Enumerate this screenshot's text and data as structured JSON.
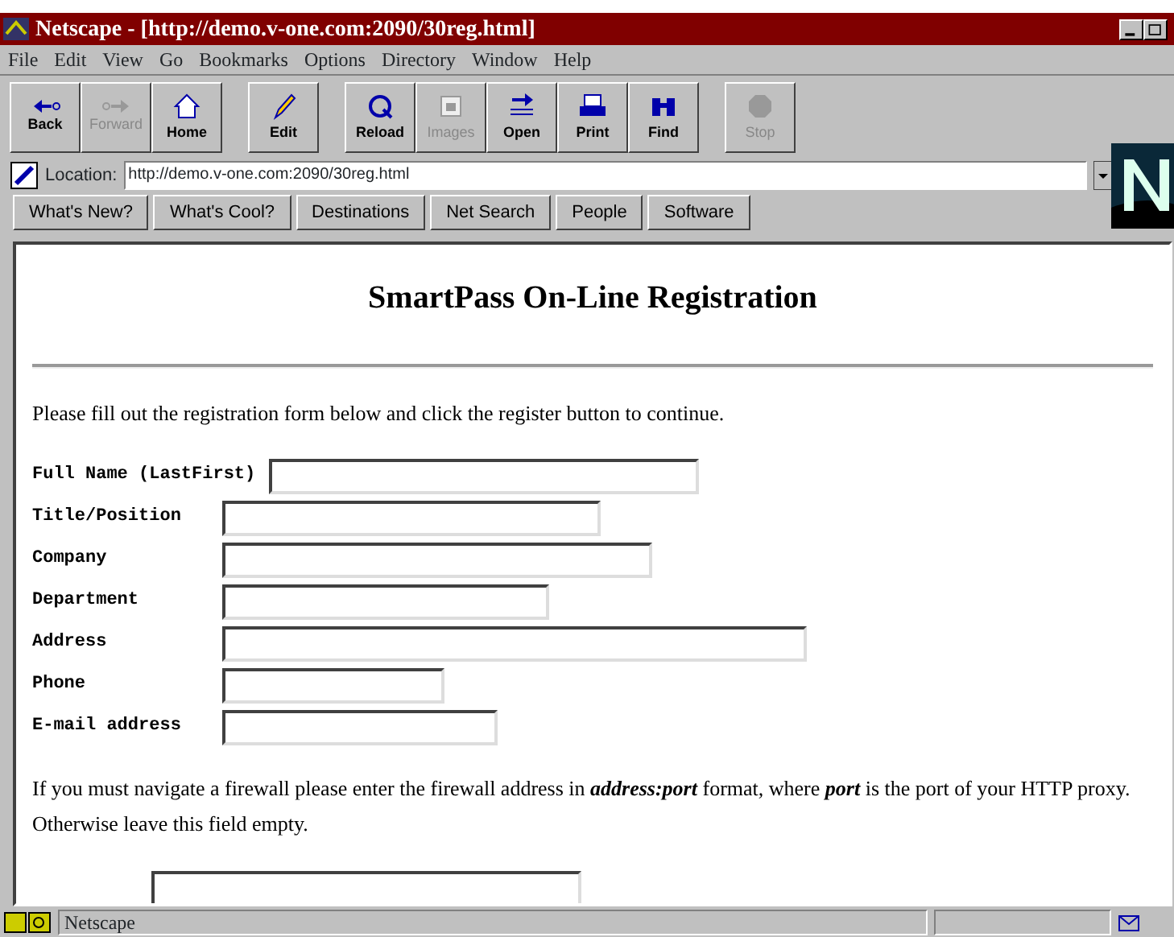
{
  "window": {
    "title": "Netscape - [http://demo.v-one.com:2090/30reg.html]"
  },
  "menu": [
    "File",
    "Edit",
    "View",
    "Go",
    "Bookmarks",
    "Options",
    "Directory",
    "Window",
    "Help"
  ],
  "toolbar": [
    {
      "label": "Back",
      "disabled": false
    },
    {
      "label": "Forward",
      "disabled": true
    },
    {
      "label": "Home",
      "disabled": false
    },
    {
      "label": "Edit",
      "disabled": false
    },
    {
      "label": "Reload",
      "disabled": false
    },
    {
      "label": "Images",
      "disabled": true
    },
    {
      "label": "Open",
      "disabled": false
    },
    {
      "label": "Print",
      "disabled": false
    },
    {
      "label": "Find",
      "disabled": false
    },
    {
      "label": "Stop",
      "disabled": true
    }
  ],
  "location": {
    "label": "Location:",
    "value": "http://demo.v-one.com:2090/30reg.html"
  },
  "directory_buttons": [
    "What's New?",
    "What's Cool?",
    "Destinations",
    "Net Search",
    "People",
    "Software"
  ],
  "page": {
    "heading": "SmartPass On-Line Registration",
    "intro": "Please fill out the registration form below and click the register button to continue.",
    "fields": [
      {
        "label": "Full Name (LastFirst)"
      },
      {
        "label": "Title/Position"
      },
      {
        "label": "Company"
      },
      {
        "label": "Department"
      },
      {
        "label": "Address"
      },
      {
        "label": "Phone"
      },
      {
        "label": "E-mail address"
      }
    ],
    "firewall_note": "If you must navigate a firewall please enter the firewall address in **address:port** format, where **port** is the port of your HTTP proxy. Otherwise leave this field empty."
  },
  "status_bar": {
    "text": "Netscape"
  }
}
